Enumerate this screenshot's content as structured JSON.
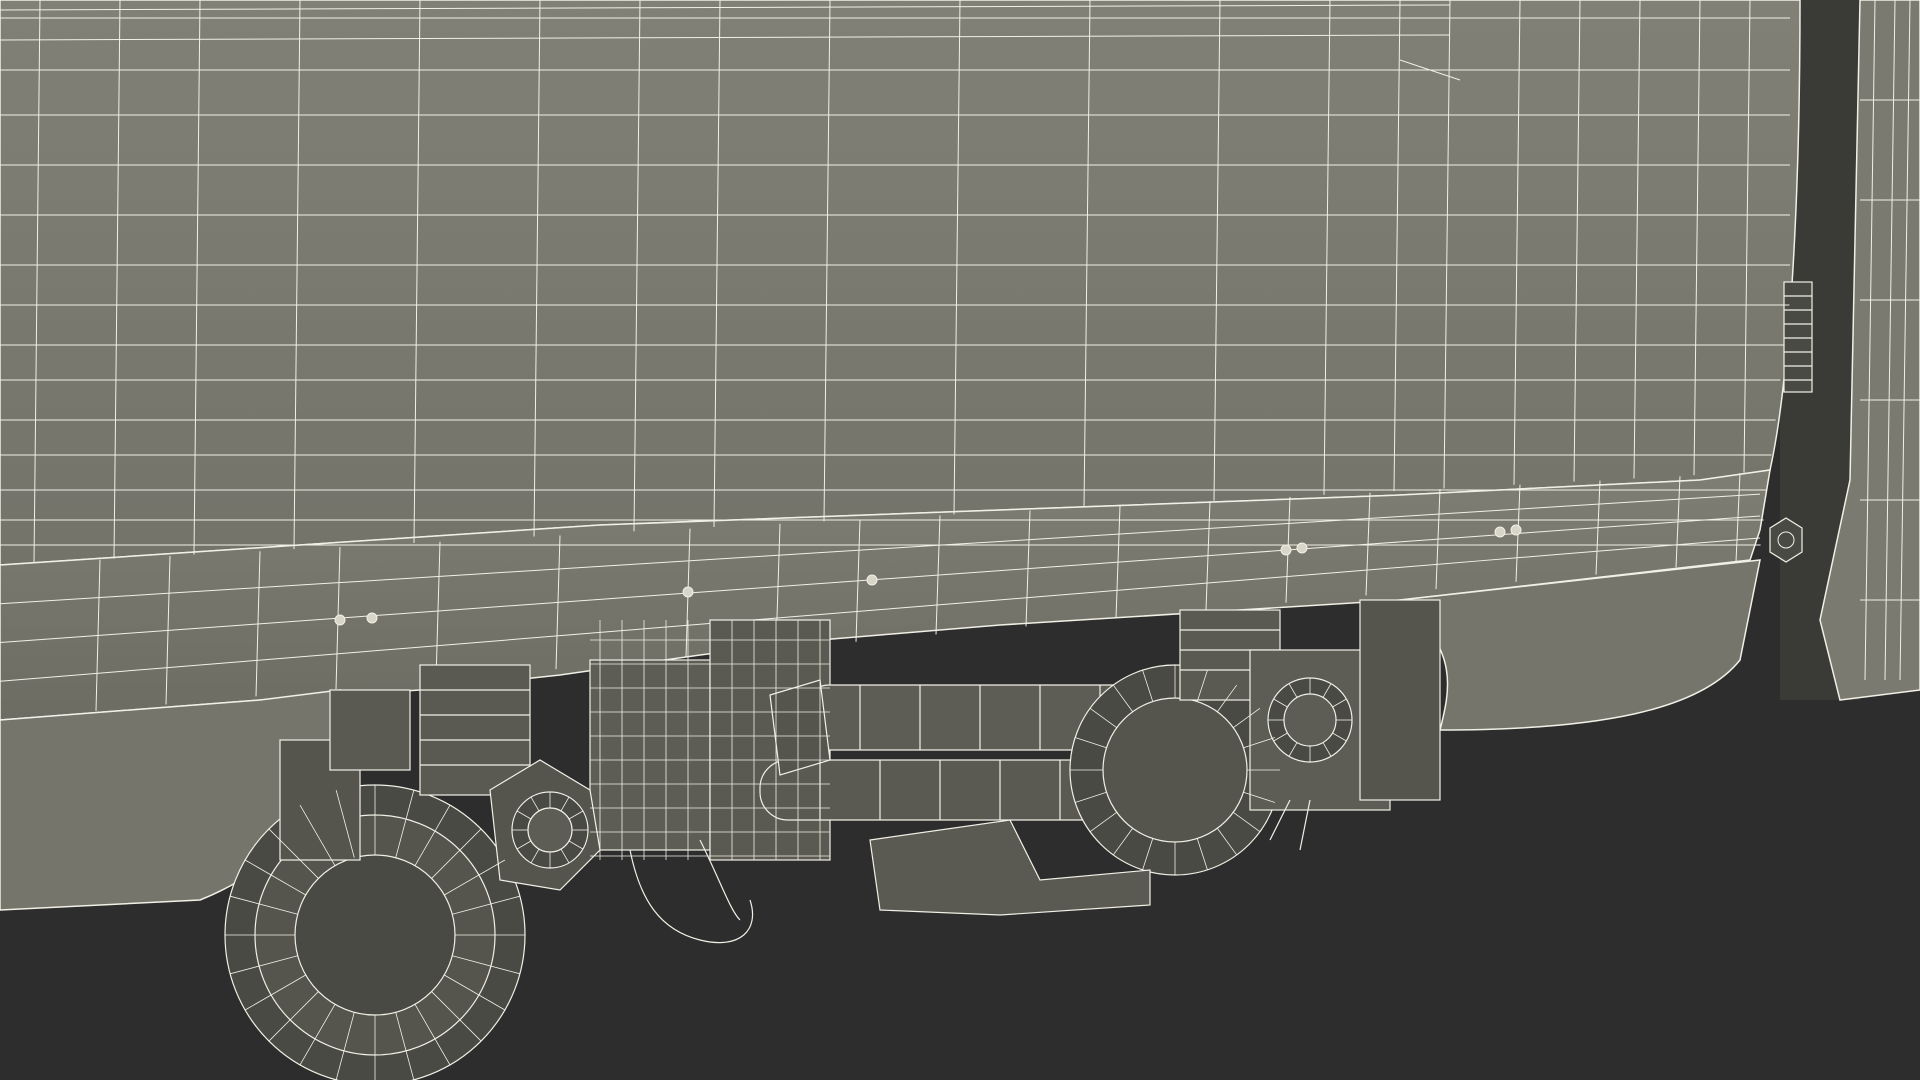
{
  "scene": {
    "background_color": "#2d2d2d",
    "body_color": "#7d7d72",
    "body_shadow_color": "#6a6a60",
    "wire_color": "#f1f0e6",
    "dark_part_color": "#3c3c38"
  }
}
